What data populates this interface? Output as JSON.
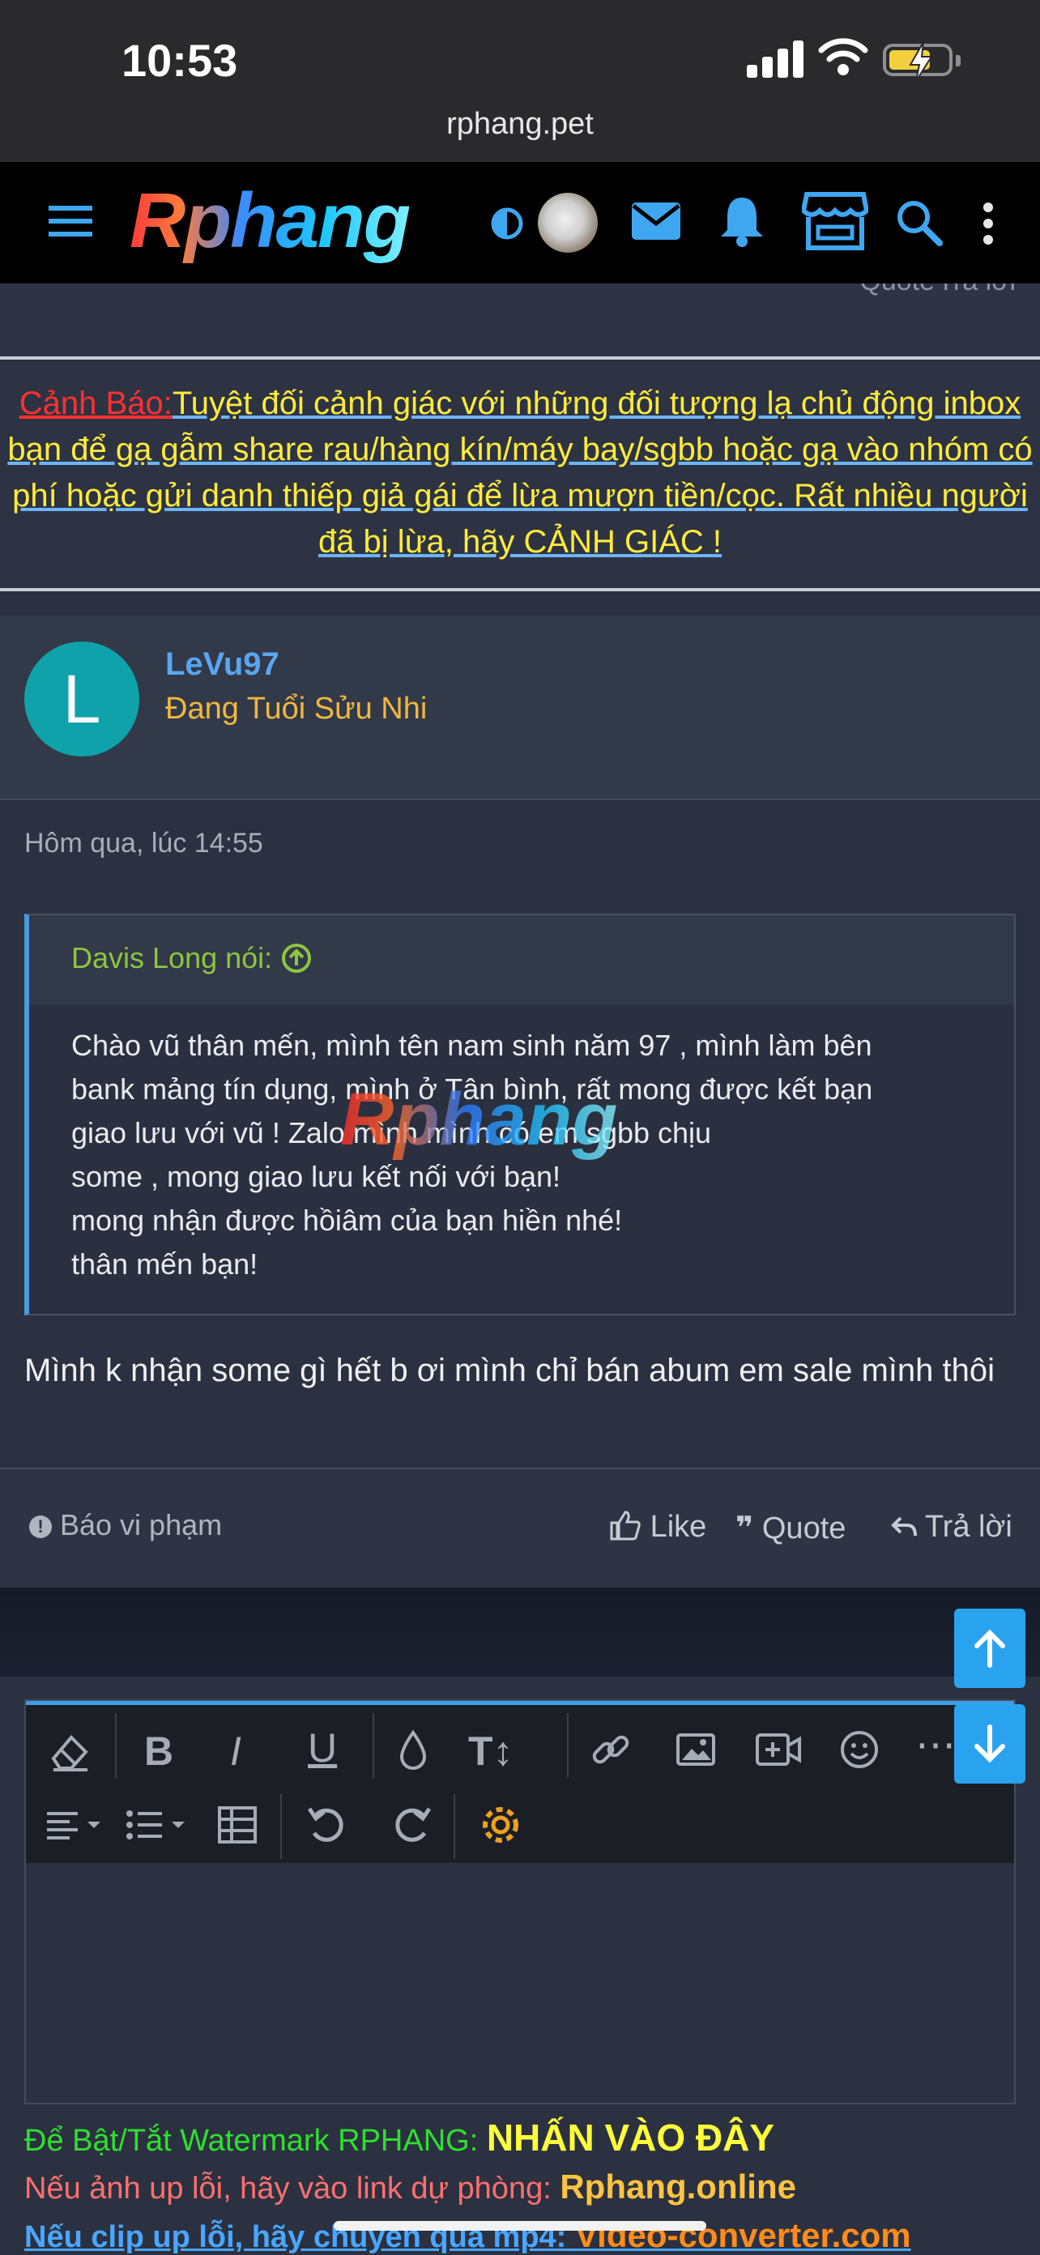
{
  "status_bar": {
    "time": "10:53",
    "url": "rphang.pet"
  },
  "nav": {
    "brand": "Rphang",
    "icons": [
      "menu-icon",
      "theme-toggle-icon",
      "user-avatar",
      "mail-icon",
      "bell-icon",
      "store-icon",
      "search-icon",
      "more-vertical-icon"
    ]
  },
  "remnant": {
    "quote": "Quote",
    "reply": "Trả lời"
  },
  "warning": {
    "title": "Cảnh Báo:",
    "body": "Tuyệt đối cảnh giác với những đối tượng lạ chủ động inbox bạn để gạ gẫm share rau/hàng kín/máy bay/sgbb hoặc gạ vào nhóm có phí hoặc gửi danh thiếp giả gái để lừa mượn tiền/cọc. Rất nhiều người đã bị lừa, hãy CẢNH GIÁC !"
  },
  "post": {
    "avatar_letter": "L",
    "username": "LeVu97",
    "user_title": "Đang Tuổi Sửu Nhi",
    "date": "Hôm qua, lúc 14:55",
    "quote": {
      "author": "Davis Long nói:",
      "lines": [
        "Chào vũ thân mến, mình tên nam sinh năm 97 , mình làm bên",
        "bank mảng tín dụng, mình ở Tân bình, rất mong được kết bạn",
        "giao lưu với vũ ! Zalo mình                     mình có em sgbb chịu",
        "some , mong giao lưu kết nối với bạn!",
        "mong nhận được hồiâm của bạn hiền nhé!",
        "thân mến bạn!"
      ]
    },
    "reply_text": "Mình k nhận some gì hết b ơi mình chỉ bán abum em sale mình thôi",
    "watermark": "Rphang",
    "actions": {
      "report": "Báo vi phạm",
      "like": "Like",
      "quote": "Quote",
      "reply": "Trả lời"
    }
  },
  "editor": {
    "toolbar_row1": [
      "eraser-icon",
      "bold-icon",
      "italic-icon",
      "underline-icon",
      "color-drop-icon",
      "text-size-icon",
      "link-icon",
      "image-icon",
      "video-icon",
      "emoji-icon",
      "more-icon"
    ],
    "toolbar_row2": [
      "align-icon",
      "list-icon",
      "table-icon",
      "undo-icon",
      "redo-icon",
      "settings-icon"
    ]
  },
  "notices": {
    "watermark_label": "Để Bật/Tắt Watermark RPHANG: ",
    "watermark_link": "NHẤN VÀO ĐÂY",
    "backup_label": "Nếu ảnh up lỗi, hãy vào link dự phòng: ",
    "backup_link": "Rphang.online",
    "clip_label": "Nếu clip up lỗi, hãy chuyển qua mp4: ",
    "clip_link": "Video-converter.com"
  },
  "colors": {
    "accent": "#2aa3ef",
    "warning_title": "#ff3030",
    "warning_text": "#ffeb3b",
    "username": "#58a6f0",
    "user_title": "#f0b840",
    "quote_author": "#8dc63f"
  }
}
